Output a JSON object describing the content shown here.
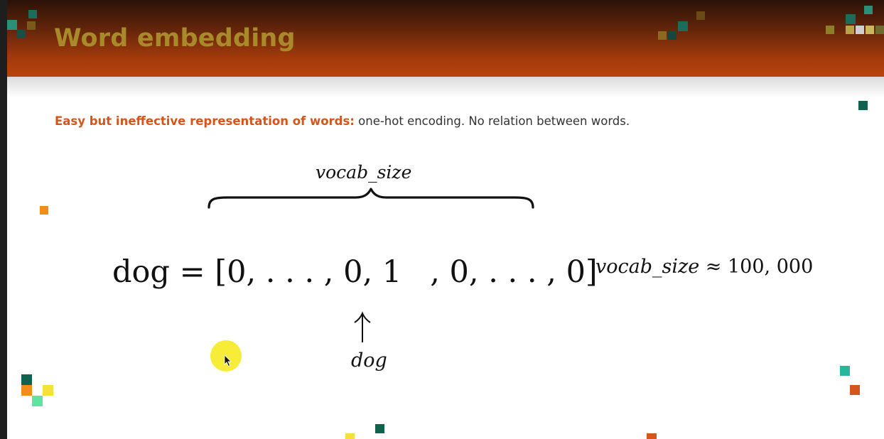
{
  "slide": {
    "title": "Word embedding",
    "subtitle_highlight": "Easy but ineffective representation of words:",
    "subtitle_rest": " one-hot encoding. No relation between words."
  },
  "math": {
    "brace_label": "vocab_size",
    "eq_lhs": "dog = [0, . . . , 0, 1",
    "eq_rhs": ", 0, . . . , 0]",
    "arrow_symbol": "↑",
    "arrow_label": "dog",
    "side_var": "vocab_size",
    "side_rest": " ≈ 100, 000"
  },
  "colors": {
    "header_orange": "#b9430e",
    "title_gold": "#a98a2a",
    "highlight_orange": "#d4561c",
    "cursor_yellow": "#f7ec2e"
  },
  "icons": {
    "cursor": "mouse-pointer-icon",
    "brace": "horizontal-brace-icon",
    "arrow": "up-arrow-icon"
  }
}
